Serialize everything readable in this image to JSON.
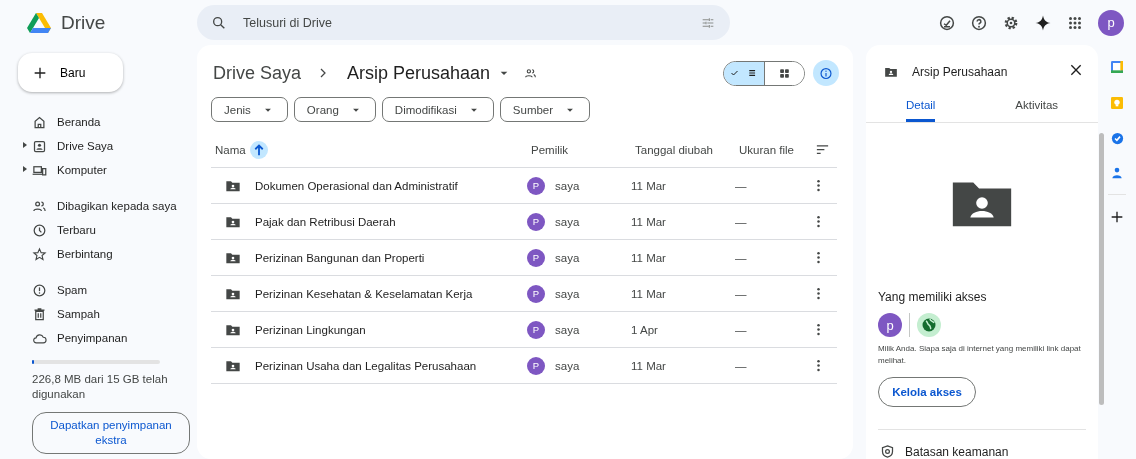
{
  "app": {
    "name": "Drive"
  },
  "search": {
    "placeholder": "Telusuri di Drive"
  },
  "account": {
    "initial": "p"
  },
  "sidebar": {
    "new_button": "Baru",
    "groups": [
      [
        {
          "label": "Beranda",
          "kind": "link"
        },
        {
          "label": "Drive Saya",
          "kind": "tree"
        },
        {
          "label": "Komputer",
          "kind": "tree"
        }
      ],
      [
        {
          "label": "Dibagikan kepada saya",
          "kind": "link"
        },
        {
          "label": "Terbaru",
          "kind": "link"
        },
        {
          "label": "Berbintang",
          "kind": "link"
        }
      ],
      [
        {
          "label": "Spam",
          "kind": "link"
        },
        {
          "label": "Sampah",
          "kind": "link"
        },
        {
          "label": "Penyimpanan",
          "kind": "link"
        }
      ]
    ],
    "storage": {
      "level": 0.015,
      "text": "226,8 MB dari 15 GB telah digunakan",
      "button": "Dapatkan penyimpanan ekstra"
    }
  },
  "breadcrumb": [
    "Drive Saya",
    "Arsip Perusahaan"
  ],
  "view_toggle": [
    {
      "kind": "list",
      "selected": true
    },
    {
      "kind": "grid",
      "selected": false
    }
  ],
  "info_button": {
    "selected": true
  },
  "filters": [
    "Jenis",
    "Orang",
    "Dimodifikasi",
    "Sumber"
  ],
  "table": {
    "columns": [
      {
        "label": "Nama",
        "sorted": true
      },
      {
        "label": "Pemilik",
        "sorted": false
      },
      {
        "label": "Tanggal diubah",
        "sorted": false
      },
      {
        "label": "Ukuran file",
        "sorted": false
      }
    ],
    "rows": [
      {
        "name": "Dokumen Operasional dan Administratif",
        "owner_initial": "P",
        "owner": "saya",
        "modified": "11 Mar",
        "size": "—"
      },
      {
        "name": "Pajak dan Retribusi Daerah",
        "owner_initial": "P",
        "owner": "saya",
        "modified": "11 Mar",
        "size": "—"
      },
      {
        "name": "Perizinan Bangunan dan Properti",
        "owner_initial": "P",
        "owner": "saya",
        "modified": "11 Mar",
        "size": "—"
      },
      {
        "name": "Perizinan Kesehatan & Keselamatan Kerja",
        "owner_initial": "P",
        "owner": "saya",
        "modified": "11 Mar",
        "size": "—"
      },
      {
        "name": "Perizinan Lingkungan",
        "owner_initial": "P",
        "owner": "saya",
        "modified": "1 Apr",
        "size": "—"
      },
      {
        "name": "Perizinan Usaha dan Legalitas Perusahaan",
        "owner_initial": "P",
        "owner": "saya",
        "modified": "11 Mar",
        "size": "—"
      }
    ]
  },
  "details": {
    "title": "Arsip Perusahaan",
    "tabs": [
      {
        "label": "Detail",
        "selected": true
      },
      {
        "label": "Aktivitas",
        "selected": false
      }
    ],
    "access_heading": "Yang memiliki akses",
    "access_initial": "p",
    "access_note": "Milik Anda. Siapa saja di internet yang memiliki link dapat melihat.",
    "manage_button": "Kelola akses",
    "security_heading": "Batasan keamanan"
  }
}
